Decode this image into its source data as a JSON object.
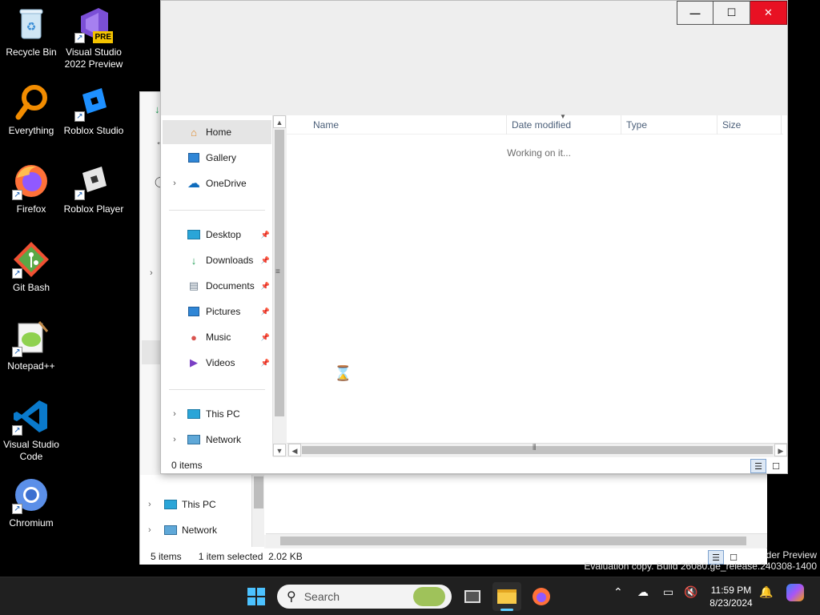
{
  "desktop": {
    "icons": [
      {
        "label": "Recycle Bin",
        "icon": "recycle-bin-icon"
      },
      {
        "label": "Visual Studio 2022 Preview",
        "icon": "visual-studio-icon",
        "badge": "PRE"
      },
      {
        "label": "Everything",
        "icon": "everything-search-icon"
      },
      {
        "label": "Roblox Studio",
        "icon": "roblox-studio-icon"
      },
      {
        "label": "Firefox",
        "icon": "firefox-icon"
      },
      {
        "label": "Roblox Player",
        "icon": "roblox-player-icon"
      },
      {
        "label": "Git Bash",
        "icon": "git-bash-icon"
      },
      {
        "label": "Notepad++",
        "icon": "notepad-plus-plus-icon"
      },
      {
        "label": "Visual Studio Code",
        "icon": "vscode-icon"
      },
      {
        "label": "Chromium",
        "icon": "chromium-icon"
      }
    ],
    "watermark": {
      "line1": "der Preview",
      "line2": "Evaluation copy. Build 26080.ge_release.240308-1400"
    }
  },
  "explorer_back": {
    "nav": [
      {
        "label": "This PC",
        "icon": "this-pc-icon"
      },
      {
        "label": "Network",
        "icon": "network-icon"
      }
    ],
    "status": {
      "items": "5 items",
      "selection": "1 item selected  2.02 KB"
    }
  },
  "explorer_front": {
    "caption": {
      "minimize": "—",
      "maximize": "☐",
      "close": "✕"
    },
    "nav": {
      "quick": [
        {
          "label": "Home",
          "icon": "home-icon",
          "selected": true
        },
        {
          "label": "Gallery",
          "icon": "gallery-icon"
        },
        {
          "label": "OneDrive",
          "icon": "onedrive-icon",
          "expandable": true
        }
      ],
      "pinned": [
        {
          "label": "Desktop",
          "icon": "desktop-folder-icon"
        },
        {
          "label": "Downloads",
          "icon": "downloads-icon"
        },
        {
          "label": "Documents",
          "icon": "documents-icon"
        },
        {
          "label": "Pictures",
          "icon": "pictures-icon"
        },
        {
          "label": "Music",
          "icon": "music-icon"
        },
        {
          "label": "Videos",
          "icon": "videos-icon"
        }
      ],
      "locations": [
        {
          "label": "This PC",
          "icon": "this-pc-icon"
        },
        {
          "label": "Network",
          "icon": "network-icon"
        }
      ]
    },
    "columns": [
      "Name",
      "Date modified",
      "Type",
      "Size"
    ],
    "loading_text": "Working on it...",
    "status": {
      "items": "0 items"
    }
  },
  "taskbar": {
    "search_placeholder": "Search",
    "apps": [
      "start-icon",
      "search-icon",
      "task-view-icon",
      "file-explorer-icon",
      "firefox-icon"
    ],
    "tray": [
      "chevron-up-icon",
      "onedrive-offline-icon",
      "display-icon",
      "volume-muted-icon",
      "notification-bell-icon",
      "copilot-icon"
    ],
    "time": "11:59 PM",
    "date": "8/23/2024"
  },
  "colors": {
    "accent": "#0078d4",
    "taskbar_bg": "#202020",
    "close_red": "#e81123",
    "header_text": "#4c607a"
  }
}
